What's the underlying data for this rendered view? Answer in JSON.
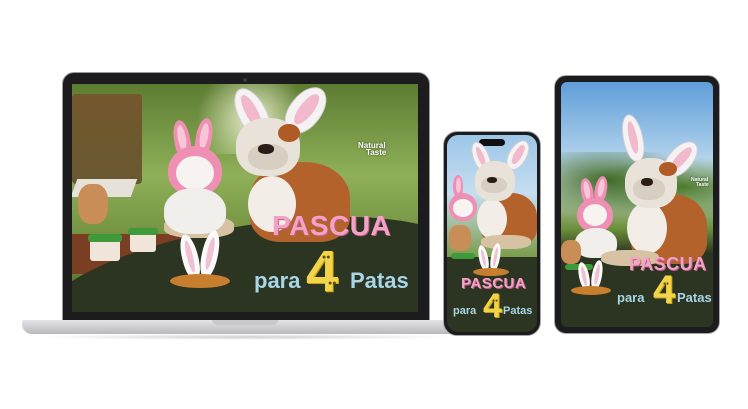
{
  "promo": {
    "title": "PASCUA",
    "para": "para",
    "number": "4",
    "patas": "Patas"
  },
  "brand": {
    "name_line1": "Natural",
    "name_line2": "Taste"
  },
  "colors": {
    "title_pink": "#f3a2c6",
    "para_blue": "#a9d6e7",
    "number_yellow": "#f1d44a",
    "band_dark": "#2c3422"
  },
  "icons": [
    "paw-print-icon",
    "bunny-ears-icon",
    "brand-logo-icon"
  ]
}
